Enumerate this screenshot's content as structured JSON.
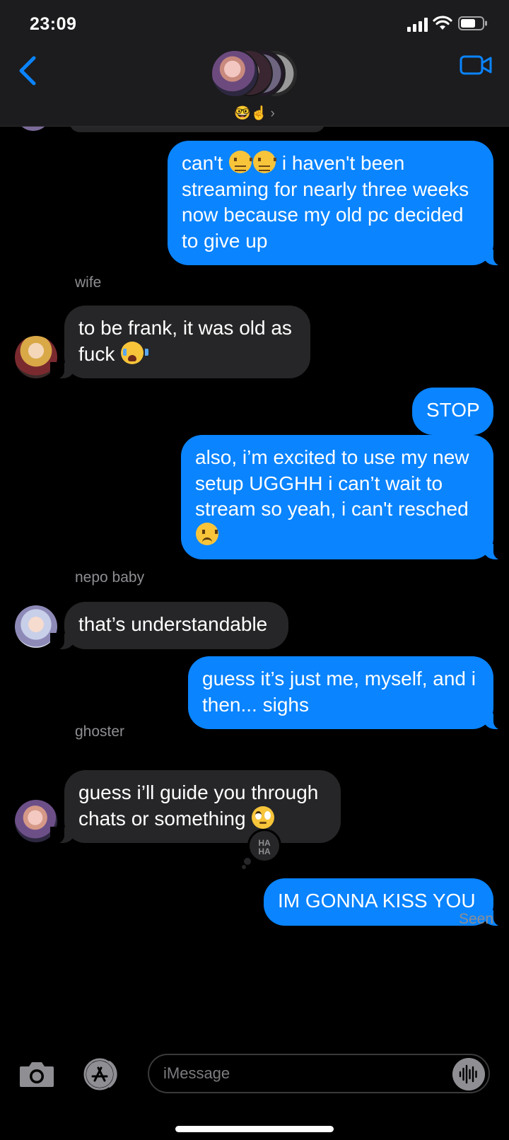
{
  "status_bar": {
    "time": "23:09"
  },
  "header": {
    "group_name": "🤓☝️",
    "chevron": "›",
    "avatar_count": 4
  },
  "messages": [
    {
      "id": "m1",
      "direction": "outgoing",
      "parts": [
        "can't ",
        "confounded-emoji",
        "confounded-emoji",
        " i haven't been streaming for nearly three weeks now because my old pc decided to give up"
      ]
    },
    {
      "id": "m2",
      "direction": "incoming",
      "sender": "wife",
      "parts": [
        "to be frank, it was old as fuck ",
        "sob-emoji"
      ]
    },
    {
      "id": "m3",
      "direction": "outgoing",
      "text": "STOP"
    },
    {
      "id": "m4",
      "direction": "outgoing",
      "parts": [
        "also, i’m excited to use my new setup UGGHH i can’t wait to stream so yeah, i can't resched ",
        "frowning-emoji"
      ]
    },
    {
      "id": "m5",
      "direction": "incoming",
      "sender": "nepo baby",
      "text": "that’s understandable"
    },
    {
      "id": "m6",
      "direction": "outgoing",
      "text": "guess it’s just me, myself, and i then... sighs"
    },
    {
      "id": "m7",
      "direction": "incoming",
      "sender": "ghoster",
      "parts": [
        "guess i’ll guide you through chats or something ",
        "face-with-rolling-eyes-emoji"
      ]
    },
    {
      "id": "m8",
      "direction": "outgoing",
      "text": "IM GONNA KISS YOU",
      "tapback": "HA HA"
    }
  ],
  "m1_text": {
    "a": "can't ",
    "b": " i haven't been streaming for nearly three weeks now because my old pc decided to give up"
  },
  "m2_text": "to be frank, it was old as fuck ",
  "m4_text": "also, i’m excited to use my new setup UGGHH i can’t wait to stream so yeah, i can't resched ",
  "m7_text": "guess i’ll guide you through chats or something ",
  "tapback": {
    "line1": "HA",
    "line2": "HA"
  },
  "read_receipt": "Seen",
  "input": {
    "placeholder": "iMessage",
    "value": ""
  },
  "icons": {
    "back": "chevron-left-icon",
    "video": "video-camera-icon",
    "camera": "camera-icon",
    "apps": "app-store-icon",
    "audio": "audio-waveform-icon"
  },
  "colors": {
    "outgoing_bubble": "#0a84ff",
    "incoming_bubble": "#262628",
    "accent": "#0a84ff",
    "background": "#000000"
  }
}
